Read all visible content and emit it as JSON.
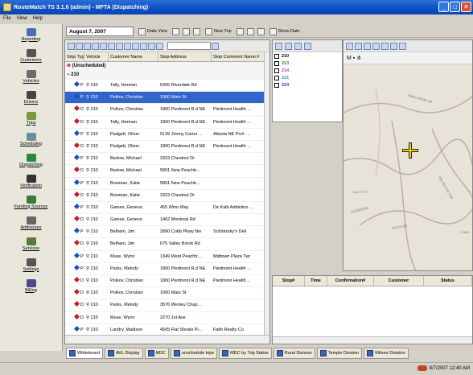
{
  "window": {
    "title": "RouteMatch TS 3.1.6 (admin) - MFTA (Dispatching)",
    "min": "_",
    "max": "□",
    "close": "✕"
  },
  "menu": [
    "File",
    "View",
    "Help"
  ],
  "sidebar": [
    {
      "label": "Reporting",
      "color": "#4a6fb5"
    },
    {
      "label": "Customers",
      "color": "#555555"
    },
    {
      "label": "Vehicles",
      "color": "#6b6b6b"
    },
    {
      "label": "Drivers",
      "color": "#444444"
    },
    {
      "label": "Trips",
      "color": "#7a9a3a"
    },
    {
      "label": "Scheduling",
      "color": "#6b8e9e"
    },
    {
      "label": "Dispatching",
      "color": "#2a8a3a"
    },
    {
      "label": "Verification",
      "color": "#333333"
    },
    {
      "label": "Funding Sources",
      "color": "#3b7a3b"
    },
    {
      "label": "Addresses",
      "color": "#666666"
    },
    {
      "label": "Services",
      "color": "#5a7a3a"
    },
    {
      "label": "Settings",
      "color": "#555555"
    },
    {
      "label": "Billing",
      "color": "#4a4a8a"
    }
  ],
  "toolbar": {
    "date": "August  7, 2007",
    "buttons": [
      "Data View",
      "New Trip",
      "Show Date"
    ]
  },
  "columns": [
    "Stop Type",
    "Vehicle",
    "Customer Name",
    "Stop Address",
    "Stop Comment Name F"
  ],
  "groups": [
    "(Unscheduled)",
    "210"
  ],
  "rows": [
    {
      "type": "P",
      "veh": "210",
      "name": "Tally, Herman",
      "addr": "6305 Riverdale Rd",
      "comment": "",
      "dot": "#1f4fb8",
      "sel": false
    },
    {
      "type": "P",
      "veh": "210",
      "name": "Polkov, Christian",
      "addr": "1000 Main St",
      "comment": "",
      "dot": "#1f4fb8",
      "sel": true
    },
    {
      "type": "D",
      "veh": "210",
      "name": "Polkov, Christian",
      "addr": "1800 Piedmont R.d NE",
      "comment": "Piedmont Health ...",
      "dot": "#c02020",
      "sel": false
    },
    {
      "type": "D",
      "veh": "210",
      "name": "Tally, Herman",
      "addr": "1800 Piedmont R.d NE",
      "comment": "Piedmont Health ...",
      "dot": "#c02020",
      "sel": false
    },
    {
      "type": "P",
      "veh": "210",
      "name": "Padgett, Oliver",
      "addr": "5139 Jimmy Carter ...",
      "comment": "Atlanta NE Prof. ...",
      "dot": "#1f4fb8",
      "sel": false
    },
    {
      "type": "D",
      "veh": "210",
      "name": "Padgett, Oliver",
      "addr": "1800 Piedmont R.d NE",
      "comment": "Piedmont Health ...",
      "dot": "#c02020",
      "sel": false
    },
    {
      "type": "P",
      "veh": "210",
      "name": "Bartow, Michael",
      "addr": "3323 Chestnut Dr",
      "comment": "",
      "dot": "#1f4fb8",
      "sel": false
    },
    {
      "type": "D",
      "veh": "210",
      "name": "Bartow, Michael",
      "addr": "5891 New Peachtr...",
      "comment": "",
      "dot": "#c02020",
      "sel": false
    },
    {
      "type": "P",
      "veh": "210",
      "name": "Bowman, Katie",
      "addr": "5891 New Peachtr...",
      "comment": "",
      "dot": "#1f4fb8",
      "sel": false
    },
    {
      "type": "D",
      "veh": "210",
      "name": "Bowman, Katie",
      "addr": "3323 Chestnut Dr",
      "comment": "",
      "dot": "#c02020",
      "sel": false
    },
    {
      "type": "P",
      "veh": "210",
      "name": "Gaines, Geneva",
      "addr": "455 Winn Way",
      "comment": "De Kalb Addiction ...",
      "dot": "#1f4fb8",
      "sel": false
    },
    {
      "type": "D",
      "veh": "210",
      "name": "Gaines, Geneva",
      "addr": "1462 Montreal Rd",
      "comment": "",
      "dot": "#c02020",
      "sel": false
    },
    {
      "type": "P",
      "veh": "210",
      "name": "Belham, Jim",
      "addr": "2890 Cobb Pkwy Nw",
      "comment": "Schlotzsky's Deli",
      "dot": "#1f4fb8",
      "sel": false
    },
    {
      "type": "D",
      "veh": "210",
      "name": "Belham, Jim",
      "addr": "675 Valley Brook Rd",
      "comment": "",
      "dot": "#c02020",
      "sel": false
    },
    {
      "type": "P",
      "veh": "210",
      "name": "Muse, Wynn",
      "addr": "1349 West Peachtr...",
      "comment": "Midtown Plaza Twr",
      "dot": "#1f4fb8",
      "sel": false
    },
    {
      "type": "P",
      "veh": "210",
      "name": "Parks, Melody",
      "addr": "1800 Piedmont R.d NE",
      "comment": "Piedmont Health ...",
      "dot": "#1f4fb8",
      "sel": false
    },
    {
      "type": "D",
      "veh": "210",
      "name": "Polkov, Christian",
      "addr": "1800 Piedmont R.d NE",
      "comment": "Piedmont Health ...",
      "dot": "#c02020",
      "sel": false
    },
    {
      "type": "D",
      "veh": "210",
      "name": "Polkov, Christian",
      "addr": "1000 Main St",
      "comment": "",
      "dot": "#c02020",
      "sel": false
    },
    {
      "type": "D",
      "veh": "210",
      "name": "Parks, Melody",
      "addr": "3576 Wesley Chap...",
      "comment": "",
      "dot": "#c02020",
      "sel": false
    },
    {
      "type": "D",
      "veh": "210",
      "name": "Muse, Wynn",
      "addr": "2270 1st Ave",
      "comment": "",
      "dot": "#c02020",
      "sel": false
    },
    {
      "type": "P",
      "veh": "210",
      "name": "Landry, Madison",
      "addr": "4505 Flat Shoals Pl...",
      "comment": "Faith Realty Co",
      "dot": "#1f4fb8",
      "sel": false
    }
  ],
  "vehicles": [
    {
      "id": "210",
      "color": "#000000"
    },
    {
      "id": "213",
      "color": "#2a7a2a"
    },
    {
      "id": "214",
      "color": "#d030d0"
    },
    {
      "id": "221",
      "color": "#20a0a0"
    },
    {
      "id": "224",
      "color": "#2040c0"
    }
  ],
  "map": {
    "streets": [
      "PIKES ROAD NE",
      "EASTTST",
      "ARLINGTON TER",
      "RIVERSIDE",
      "DOUGLAS",
      "CHAR"
    ]
  },
  "stops_table": {
    "columns": [
      "Stop#",
      "Time",
      "Confirmation#",
      "Customer",
      "Status"
    ]
  },
  "tabs": [
    "Whiteboard",
    "AVL Display",
    "MDC",
    "unschedule trips",
    "MDC by Trip Status",
    "Rural Division",
    "Temple Division",
    "Killeen Division"
  ],
  "status": {
    "clock": "8/7/2007  12:40 AM"
  }
}
